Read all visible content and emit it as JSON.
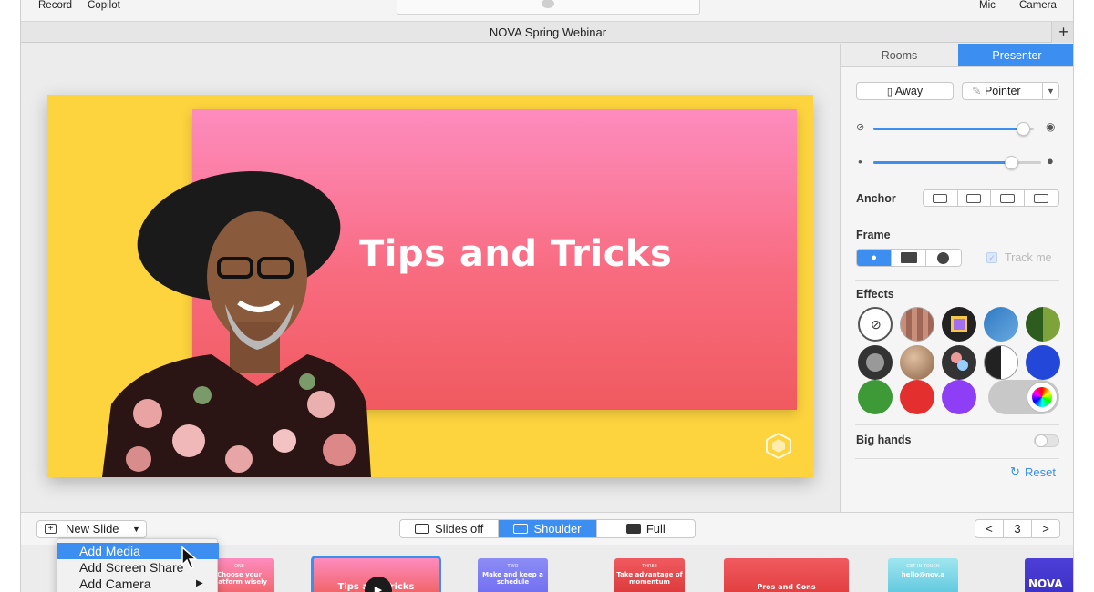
{
  "toolbar": {
    "left_items": [
      "Record",
      "Copilot"
    ],
    "right_items": [
      "Mic",
      "Camera"
    ]
  },
  "window": {
    "title": "NOVA Spring Webinar",
    "add_label": "+"
  },
  "slide": {
    "title": "Tips and Tricks"
  },
  "panel": {
    "tabs": [
      {
        "label": "Rooms",
        "active": false
      },
      {
        "label": "Presenter",
        "active": true
      }
    ],
    "away_label": "Away",
    "pointer_label": "Pointer",
    "opacity_slider": 0.93,
    "size_slider": 0.82,
    "anchor_label": "Anchor",
    "frame_label": "Frame",
    "track_me_label": "Track me",
    "effects_label": "Effects",
    "big_hands_label": "Big hands",
    "reset_label": "Reset",
    "colors": {
      "accent": "#3d8ef1"
    }
  },
  "bottom": {
    "new_slide_label": "New Slide",
    "views": [
      {
        "label": "Slides off",
        "active": false
      },
      {
        "label": "Shoulder",
        "active": true
      },
      {
        "label": "Full",
        "active": false
      }
    ],
    "page": "3",
    "prev": "<",
    "next": ">"
  },
  "menu": {
    "items": [
      {
        "label": "Add Media",
        "selected": true
      },
      {
        "label": "Add Screen Share",
        "selected": false
      },
      {
        "label": "Add Camera",
        "selected": false,
        "submenu": true
      }
    ]
  },
  "thumbnails": [
    {
      "small": "ONE",
      "text": "Choose your platform wisely"
    },
    {
      "text": "Tips and Tricks"
    },
    {
      "small": "TWO",
      "text": "Make and keep a schedule"
    },
    {
      "small": "THREE",
      "text": "Take advantage of momentum"
    },
    {
      "text": "Pros and Cons"
    },
    {
      "small": "GET IN TOUCH",
      "text": "hello@nov.a"
    },
    {
      "text": "NOVA"
    }
  ]
}
